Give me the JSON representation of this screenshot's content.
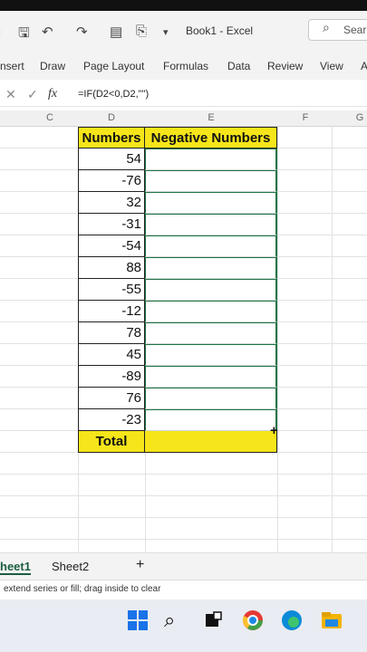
{
  "app": {
    "title": "Book1 - Excel",
    "search_placeholder": "Sear"
  },
  "ribbon_tabs": [
    "nsert",
    "Draw",
    "Page Layout",
    "Formulas",
    "Data",
    "Review",
    "View",
    "A"
  ],
  "formula_bar": {
    "formula": "=IF(D2<0,D2,\"\")",
    "fx": "fx"
  },
  "columns": [
    "C",
    "D",
    "E",
    "F",
    "G"
  ],
  "table": {
    "header_numbers": "Numbers",
    "header_negative": "Negative Numbers",
    "numbers": [
      "54",
      "-76",
      "32",
      "-31",
      "-54",
      "88",
      "-55",
      "-12",
      "78",
      "45",
      "-89",
      "76",
      "-23"
    ],
    "total_label": "Total"
  },
  "sheets": {
    "sheet1": "heet1",
    "sheet2": "Sheet2",
    "add": "+"
  },
  "status": "extend series or fill; drag inside to clear",
  "colors": {
    "header_fill": "#f6e51a",
    "excel_green": "#217346"
  },
  "icons": [
    "save-icon",
    "undo-icon",
    "redo-icon",
    "search-icon",
    "windows-icon",
    "chrome-icon",
    "edge-icon",
    "file-explorer-icon"
  ]
}
